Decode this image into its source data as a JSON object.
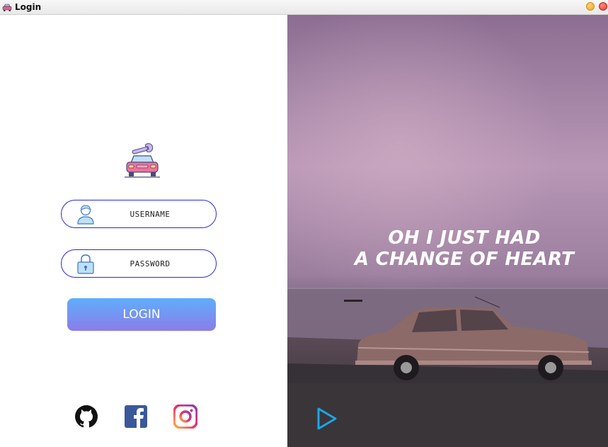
{
  "window": {
    "title": "Login",
    "icon": "car-icon"
  },
  "login_form": {
    "logo": "car-repair-logo",
    "username": {
      "placeholder": "USERNAME",
      "value": "",
      "icon": "user-icon"
    },
    "password": {
      "placeholder": "PASSWORD",
      "value": "",
      "icon": "lock-icon"
    },
    "login_label": "LOGIN"
  },
  "social_links": [
    {
      "name": "github",
      "icon": "github-icon"
    },
    {
      "name": "facebook",
      "icon": "facebook-icon"
    },
    {
      "name": "instagram",
      "icon": "instagram-icon"
    }
  ],
  "hero": {
    "line1": "OH I JUST HAD",
    "line2": "A CHANGE OF HEART",
    "play_icon": "play-icon"
  },
  "colors": {
    "field_border": "#2a2ad8",
    "button_top": "#5faefc",
    "button_bottom": "#8a7de8",
    "play_icon": "#1aa7e8",
    "min_button": "#f6a21a",
    "close_button": "#e53a30"
  }
}
